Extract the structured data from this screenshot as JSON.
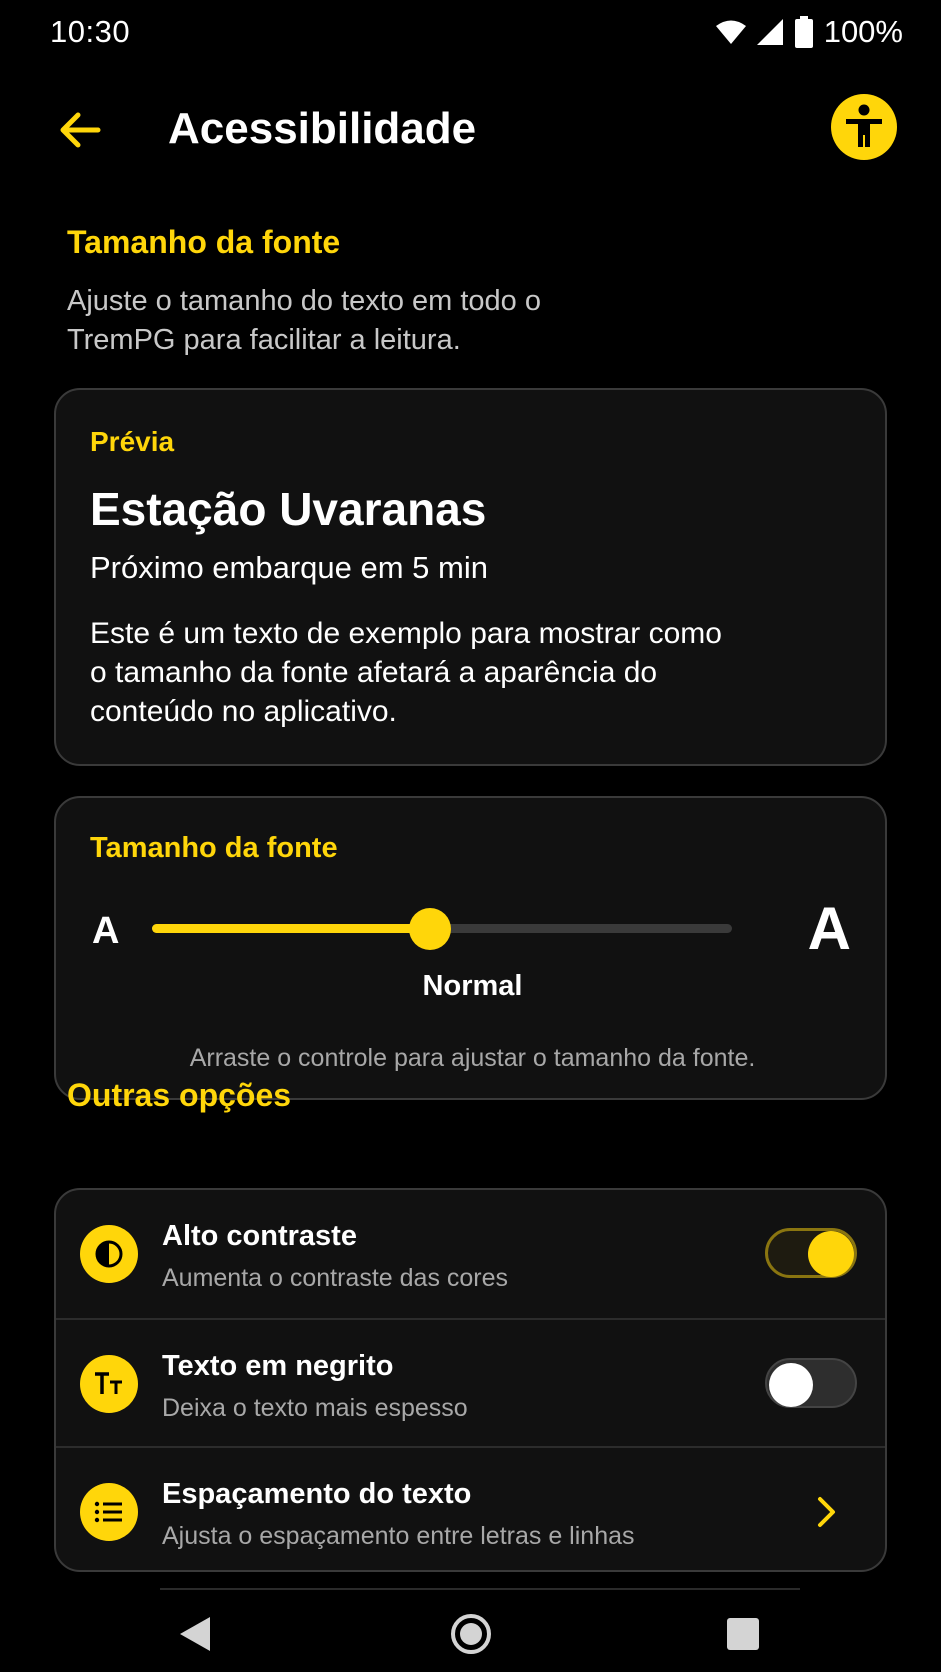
{
  "status_bar": {
    "time": "10:30",
    "battery": "100%"
  },
  "app_bar": {
    "title": "Acessibilidade"
  },
  "font_size_section": {
    "title": "Tamanho da fonte",
    "description": "Ajuste o tamanho do texto em todo o TremPG para facilitar a leitura."
  },
  "preview": {
    "label": "Prévia",
    "heading": "Estação Uvaranas",
    "subheading": "Próximo embarque em 5 min",
    "body": "Este é um texto de exemplo para mostrar como o tamanho da fonte afetará a aparência do conteúdo no aplicativo."
  },
  "font_control": {
    "title": "Tamanho da fonte",
    "small_label": "A",
    "large_label": "A",
    "value_label": "Normal",
    "value_fraction": 0.48,
    "hint": "Arraste o controle para ajustar o tamanho da fonte."
  },
  "other_options": {
    "title": "Outras opções",
    "items": [
      {
        "title": "Alto contraste",
        "description": "Aumenta o contraste das cores",
        "icon": "contrast-icon",
        "control": "toggle",
        "enabled": true
      },
      {
        "title": "Texto em negrito",
        "description": "Deixa o texto mais espesso",
        "icon": "text-size-icon",
        "control": "toggle",
        "enabled": false
      },
      {
        "title": "Espaçamento do texto",
        "description": "Ajusta o espaçamento entre letras e linhas",
        "icon": "list-icon",
        "control": "chevron"
      }
    ]
  },
  "colors": {
    "accent": "#ffd60a",
    "background": "#000000",
    "card": "#111111"
  }
}
